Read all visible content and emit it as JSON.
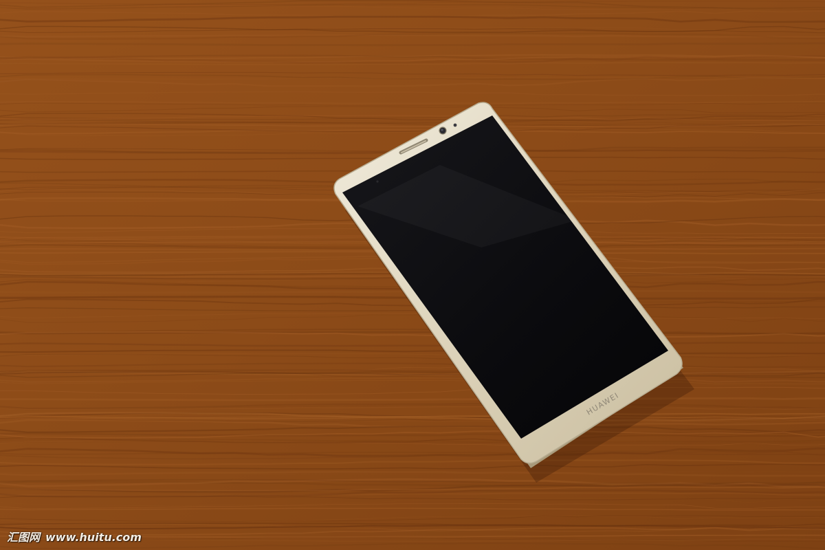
{
  "photo": {
    "subject": "smartphone",
    "surface": "wooden-table",
    "colors": {
      "wood_base": "#8a4a17",
      "wood_light": "#a45f27",
      "wood_dark": "#6b3510",
      "phone_body": "#dfd6bf",
      "phone_edge": "#b9ae93",
      "screen": "#0d0d10"
    }
  },
  "phone": {
    "brand_text": "HUAWEI",
    "icons": [
      "front-camera-icon",
      "earpiece-speaker-icon",
      "proximity-sensor-icon"
    ]
  },
  "watermark": {
    "site_name": "汇图网",
    "site_url": "www.huitu.com"
  }
}
